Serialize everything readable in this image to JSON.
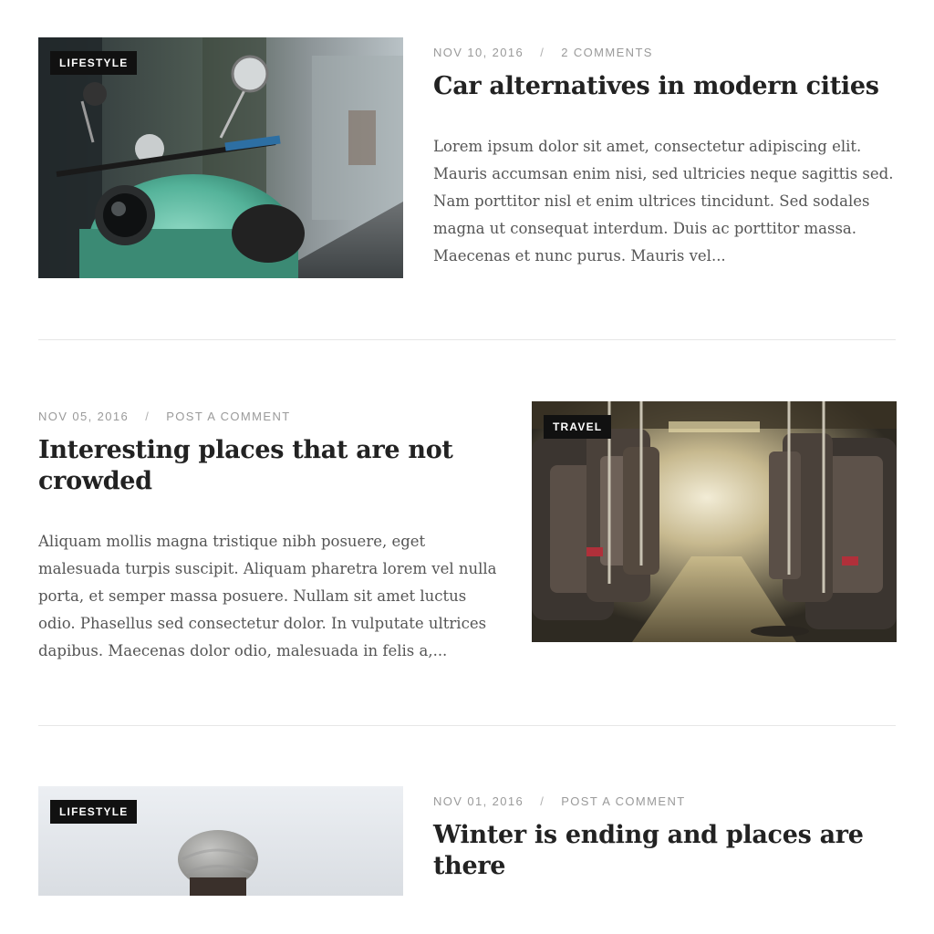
{
  "posts": [
    {
      "category": "LIFESTYLE",
      "date": "NOV 10, 2016",
      "separator": "/",
      "comments": "2 COMMENTS",
      "title": "Car alternatives in modern cities",
      "excerpt": "Lorem ipsum dolor sit amet, consectetur adipiscing elit. Mauris accumsan enim nisi, sed ultricies neque sagittis sed. Nam porttitor nisl et enim ultrices tincidunt. Sed sodales magna ut consequat interdum. Duis ac porttitor massa. Maecenas et nunc purus. Mauris vel..."
    },
    {
      "category": "TRAVEL",
      "date": "NOV 05, 2016",
      "separator": "/",
      "comments": "POST A COMMENT",
      "title": "Interesting places that are not crowded",
      "excerpt": "Aliquam mollis magna tristique nibh posuere, eget malesuada turpis suscipit. Aliquam pharetra lorem vel nulla porta, et semper massa posuere. Nullam sit amet luctus odio. Phasellus sed consectetur dolor. In vulputate ultrices dapibus. Maecenas dolor odio, malesuada in felis a,..."
    },
    {
      "category": "LIFESTYLE",
      "date": "NOV 01, 2016",
      "separator": "/",
      "comments": "POST A COMMENT",
      "title": "Winter is ending and places are there",
      "excerpt": ""
    }
  ],
  "colors": {
    "badge_bg": "#111111",
    "meta_text": "#9a9a9a",
    "title_text": "#222222",
    "body_text": "#555555",
    "divider": "#e6e6e6"
  }
}
